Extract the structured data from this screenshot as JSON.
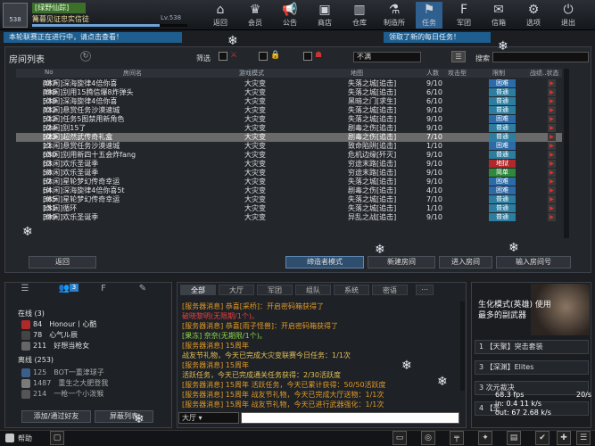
{
  "user": {
    "avatar_label": "538",
    "name": "[绿野仙踪]",
    "title": "篝暮见证忠实信徒",
    "level": "Lv.538",
    "exp_fraction": 0.82
  },
  "nav": [
    {
      "icon": "⌂",
      "label": "返回"
    },
    {
      "icon": "♛",
      "label": "会员"
    },
    {
      "icon": "📢",
      "label": "公告"
    },
    {
      "icon": "▣",
      "label": "商店"
    },
    {
      "icon": "▥",
      "label": "仓库"
    },
    {
      "icon": "⚗",
      "label": "制造所"
    },
    {
      "icon": "⚑",
      "label": "任务"
    },
    {
      "icon": "F",
      "label": "军团"
    },
    {
      "icon": "✉",
      "label": "信箱"
    },
    {
      "icon": "⚙",
      "label": "选项"
    },
    {
      "icon": "⏻",
      "label": "退出"
    }
  ],
  "notices": {
    "left": "本轮联赛正在进行中，请点击查看！",
    "right": "领取了新的每日任务！"
  },
  "room": {
    "title": "房间列表",
    "filter_label": "筛选",
    "not_full": "不满",
    "search_label": "搜索",
    "headers": [
      "No",
      "房间名",
      "游戏模式",
      "地图",
      "人数",
      "攻击型",
      "限制",
      "战绩..状态"
    ],
    "rows": [
      {
        "no": "487",
        "name": "[休闲]深海旋律4倍你喜",
        "mode": "大灾变",
        "map": "失落之城[追击]",
        "count": "9/10",
        "diff": "困难",
        "dc": "d-hard"
      },
      {
        "no": "498",
        "name": "[休闲]别用15腾信爆8炸弹头",
        "mode": "大灾变",
        "map": "失落之城[追击]",
        "count": "6/10",
        "diff": "普通",
        "dc": "d-norm"
      },
      {
        "no": "538",
        "name": "[休闲]深海旋律4倍你喜",
        "mode": "大灾变",
        "map": "黑暗之门[求生]",
        "count": "6/10",
        "diff": "普通",
        "dc": "d-norm"
      },
      {
        "no": "432",
        "name": "[休闲]悬赏任务沙漠速城",
        "mode": "大灾变",
        "map": "失落之城[追击]",
        "count": "9/10",
        "diff": "普通",
        "dc": "d-norm"
      },
      {
        "no": "512",
        "name": "[休闲]任务5图禁用新角色",
        "mode": "大灾变",
        "map": "失落之城[追击]",
        "count": "9/10",
        "diff": "困难",
        "dc": "d-hard"
      },
      {
        "no": "524",
        "name": "[休闲]别15了",
        "mode": "大灾变",
        "map": "剧毒之伤[追击]",
        "count": "9/10",
        "diff": "普通",
        "dc": "d-norm"
      },
      {
        "no": "523",
        "name": "[休闲]超然武传奇礼盒",
        "mode": "大灾变",
        "map": "剧毒之伤[追击]",
        "count": "7/10",
        "diff": "普通",
        "dc": "d-norm",
        "sel": true
      },
      {
        "no": "11",
        "name": "[休闲]悬赏任务沙漠速城",
        "mode": "大灾变",
        "map": "致命陷阱[追击]",
        "count": "1/10",
        "diff": "困难",
        "dc": "d-hard"
      },
      {
        "no": "650",
        "name": "[休闲]别用新四十五会炸fang",
        "mode": "大灾变",
        "map": "危机边缘[歼灭]",
        "count": "9/10",
        "diff": "普通",
        "dc": "d-norm"
      },
      {
        "no": "63",
        "name": "[休闲]欢乐圣诞季",
        "mode": "大灾变",
        "map": "穷途末路[追击]",
        "count": "9/10",
        "diff": "地狱",
        "dc": "d-hell"
      },
      {
        "no": "50",
        "name": "[休闲]欢乐圣诞季",
        "mode": "大灾变",
        "map": "穷途末路[追击]",
        "count": "9/10",
        "diff": "简单",
        "dc": "d-easy"
      },
      {
        "no": "62",
        "name": "[休闲]星轮梦幻传奇幸运",
        "mode": "大灾变",
        "map": "失落之城[追击]",
        "count": "9/10",
        "diff": "困难",
        "dc": "d-hard"
      },
      {
        "no": "64",
        "name": "[休闲]深海旋律4倍你喜5t",
        "mode": "大灾变",
        "map": "剧毒之伤[追击]",
        "count": "4/10",
        "diff": "困难",
        "dc": "d-hard"
      },
      {
        "no": "365",
        "name": "[休闲]星轮梦幻传奇幸运",
        "mode": "大灾变",
        "map": "失落之城[追击]",
        "count": "7/10",
        "diff": "普通",
        "dc": "d-norm"
      },
      {
        "no": "151",
        "name": "[休闲]循环",
        "mode": "大灾变",
        "map": "失落之城[追击]",
        "count": "1/10",
        "diff": "普通",
        "dc": "d-norm"
      },
      {
        "no": "399",
        "name": "[休闲]欢乐圣诞季",
        "mode": "大灾变",
        "map": "异乱之战[追击]",
        "count": "9/10",
        "diff": "普通",
        "dc": "d-norm"
      }
    ],
    "buttons": {
      "back": "返回",
      "spectate": "缔造者模式",
      "new_room": "新建房间",
      "enter": "进入房间",
      "enter_no": "输入房间号"
    }
  },
  "friends": {
    "badge": "3",
    "online_label": "在线 (3)",
    "online": [
      {
        "level": "84",
        "name": "Honour丨心酷"
      },
      {
        "level": "78",
        "name": "心气ル辰"
      },
      {
        "level": "211",
        "name": "好想当枪女"
      }
    ],
    "offline_label": "离线 (253)",
    "offline": [
      {
        "level": "125",
        "name": "BOT一重津球子"
      },
      {
        "level": "1487",
        "name": "重生之大肥登我"
      },
      {
        "level": "214",
        "name": "一枪一个小泼猴"
      }
    ],
    "add_btn": "添加/通过好友",
    "block_btn": "屏蔽列表"
  },
  "chat": {
    "tabs": [
      "全部",
      "大厅",
      "军团",
      "组队",
      "系统",
      "密语"
    ],
    "lines": [
      {
        "c": "c-sys",
        "t": "[服务器消息] 恭喜[采桥]：开启密码箱获得了"
      },
      {
        "c": "c-red",
        "t": "破晓黎明(无限期/1个)。"
      },
      {
        "c": "c-sys",
        "t": "[服务器消息] 恭喜[雨子怪兽]：开启密码箱获得了"
      },
      {
        "c": "c-green",
        "t": "[果冻] 奈奈(无期限/1个)。"
      },
      {
        "c": "c-sys",
        "t": "[服务器消息] 15周年"
      },
      {
        "c": "c-hl",
        "t": "战友节礼物，今天已完成大灾变联赛今日任务：1/1次"
      },
      {
        "c": "c-sys",
        "t": "[服务器消息] 15周年"
      },
      {
        "c": "c-hl",
        "t": "活跃任务，今天已完成通关任务获得：2/30活跃度"
      },
      {
        "c": "c-sys",
        "t": "[服务器消息] 15周年 活跃任务，今天已累计获得：50/50活跃度"
      },
      {
        "c": "c-sys",
        "t": "[服务器消息] 15周年 战友节礼物，今天已完成大厅送物：1/1次"
      },
      {
        "c": "c-sys",
        "t": "[服务器消息] 15周年 战友节礼物，今天已进行武器强化：1/1次"
      }
    ],
    "channel": "大厅"
  },
  "mode": {
    "title": "生化模式(英雄) 使用最多的副武器",
    "items": [
      "1 【天聚】突击套装",
      "3 【深渊】Elites",
      "3 次元裁决",
      "4 【圣"
    ],
    "fps": "68.3 fps",
    "ping": "20/s",
    "net1": "in: 0.4 11 k/s",
    "net2": "out: 67 2.68 k/s"
  },
  "bottom": {
    "help": "帮助"
  }
}
